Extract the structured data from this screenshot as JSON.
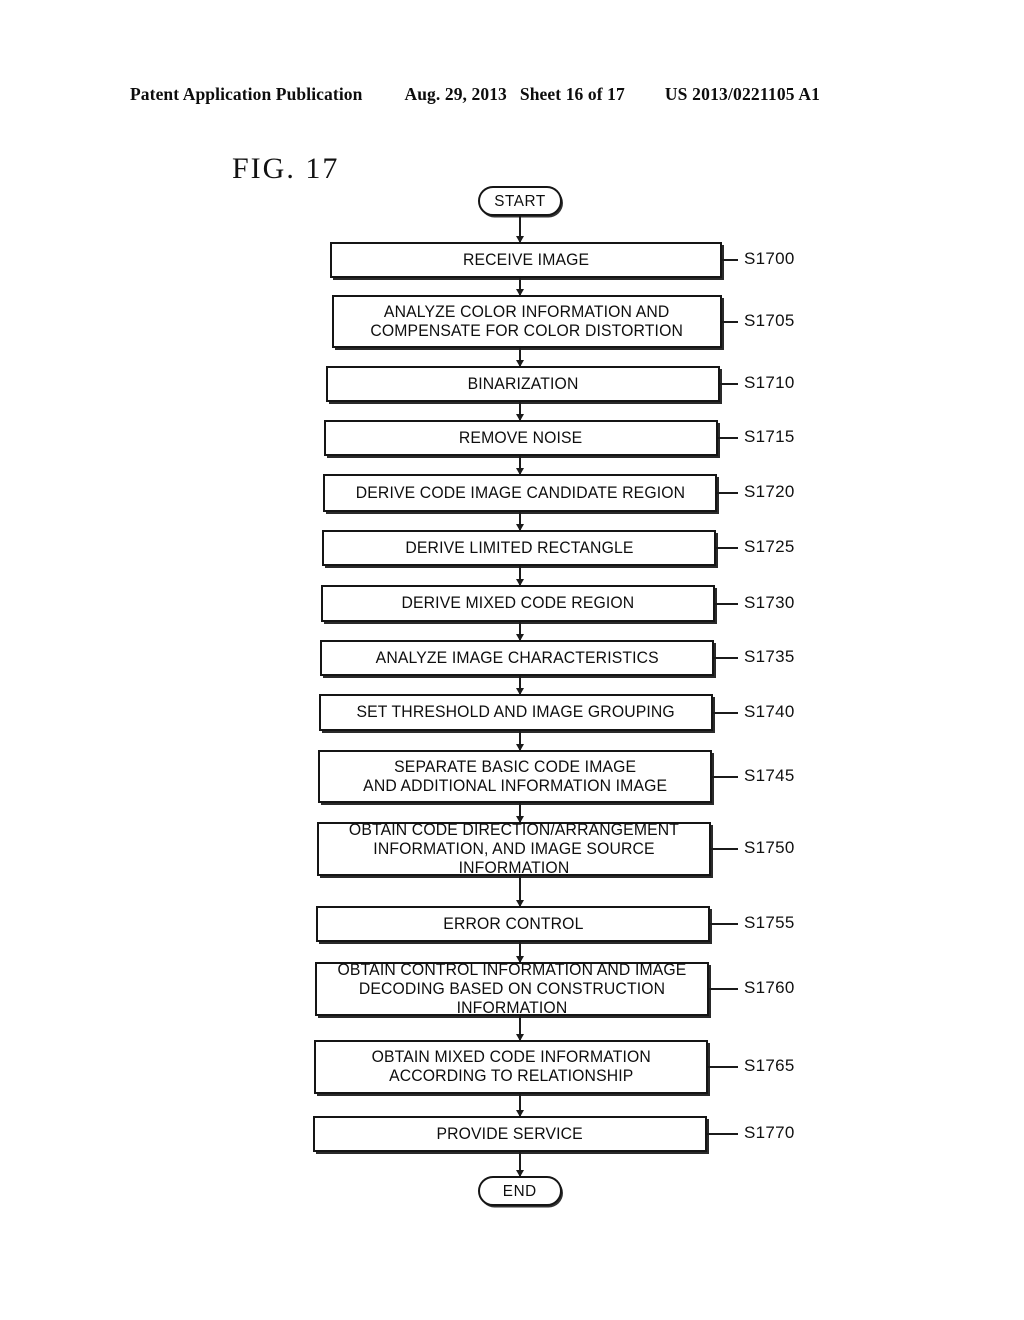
{
  "header": {
    "publication": "Patent Application Publication",
    "date": "Aug. 29, 2013",
    "sheet": "Sheet 16 of 17",
    "doc_number": "US 2013/0221105 A1"
  },
  "figure": {
    "label": "FIG. 17"
  },
  "flowchart": {
    "start_label": "START",
    "end_label": "END",
    "steps": [
      {
        "text": "RECEIVE IMAGE",
        "ref": "S1700"
      },
      {
        "text": "ANALYZE COLOR INFORMATION AND\nCOMPENSATE FOR COLOR DISTORTION",
        "ref": "S1705"
      },
      {
        "text": "BINARIZATION",
        "ref": "S1710"
      },
      {
        "text": "REMOVE NOISE",
        "ref": "S1715"
      },
      {
        "text": "DERIVE CODE IMAGE CANDIDATE REGION",
        "ref": "S1720"
      },
      {
        "text": "DERIVE LIMITED RECTANGLE",
        "ref": "S1725"
      },
      {
        "text": "DERIVE MIXED CODE REGION",
        "ref": "S1730"
      },
      {
        "text": "ANALYZE IMAGE CHARACTERISTICS",
        "ref": "S1735"
      },
      {
        "text": "SET THRESHOLD AND IMAGE GROUPING",
        "ref": "S1740"
      },
      {
        "text": "SEPARATE BASIC CODE IMAGE\nAND ADDITIONAL INFORMATION IMAGE",
        "ref": "S1745"
      },
      {
        "text": "OBTAIN CODE DIRECTION/ARRANGEMENT\nINFORMATION, AND IMAGE SOURCE INFORMATION",
        "ref": "S1750"
      },
      {
        "text": "ERROR CONTROL",
        "ref": "S1755"
      },
      {
        "text": "OBTAIN CONTROL INFORMATION AND IMAGE\nDECODING BASED ON CONSTRUCTION INFORMATION",
        "ref": "S1760"
      },
      {
        "text": "OBTAIN MIXED CODE INFORMATION\nACCORDING TO RELATIONSHIP",
        "ref": "S1765"
      },
      {
        "text": "PROVIDE SERVICE",
        "ref": "S1770"
      }
    ]
  }
}
